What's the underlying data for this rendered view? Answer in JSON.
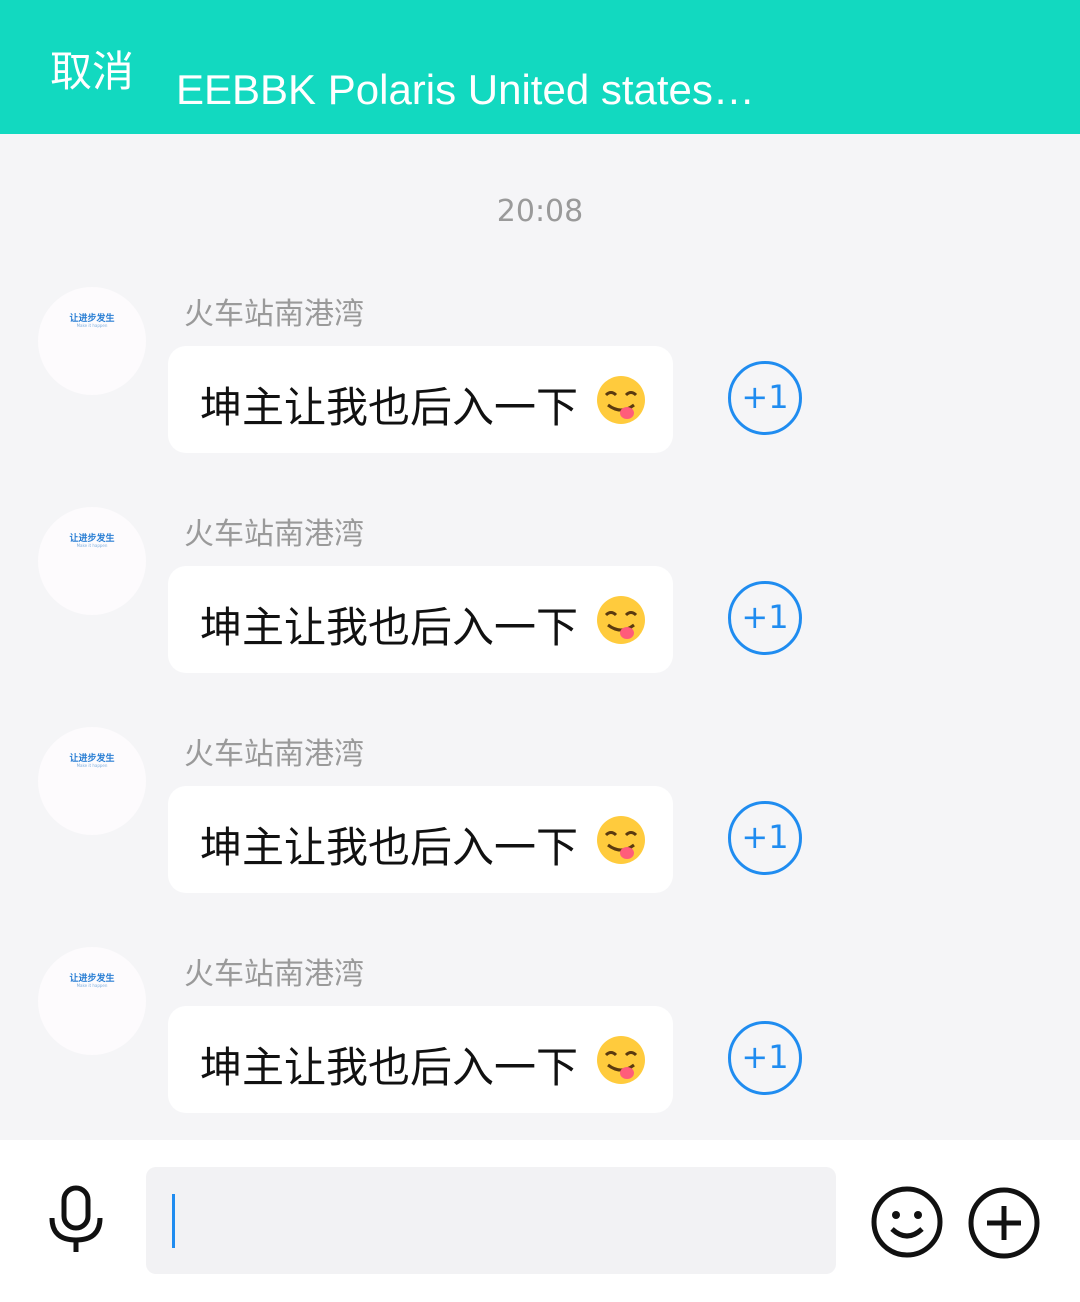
{
  "header": {
    "cancel_label": "取消",
    "title": "EEBBK Polaris United states…"
  },
  "time_label": "20:08",
  "messages": [
    {
      "sender": "火车站南港湾",
      "avatar_text": "让进步发生",
      "avatar_sub": "Make it happen",
      "text": "坤主让我也后入一下",
      "emoji": "savoring-face-emoji",
      "plus_label": "+1"
    },
    {
      "sender": "火车站南港湾",
      "avatar_text": "让进步发生",
      "avatar_sub": "Make it happen",
      "text": "坤主让我也后入一下",
      "emoji": "savoring-face-emoji",
      "plus_label": "+1"
    },
    {
      "sender": "火车站南港湾",
      "avatar_text": "让进步发生",
      "avatar_sub": "Make it happen",
      "text": "坤主让我也后入一下",
      "emoji": "savoring-face-emoji",
      "plus_label": "+1"
    },
    {
      "sender": "火车站南港湾",
      "avatar_text": "让进步发生",
      "avatar_sub": "Make it happen",
      "text": "坤主让我也后入一下",
      "emoji": "savoring-face-emoji",
      "plus_label": "+1"
    }
  ],
  "composer": {
    "input_value": "",
    "icons": [
      "microphone-icon",
      "smile-icon",
      "add-icon"
    ]
  },
  "colors": {
    "header_bg": "#12d9c0",
    "accent_blue": "#1f8cf0",
    "page_bg": "#f5f5f7"
  }
}
